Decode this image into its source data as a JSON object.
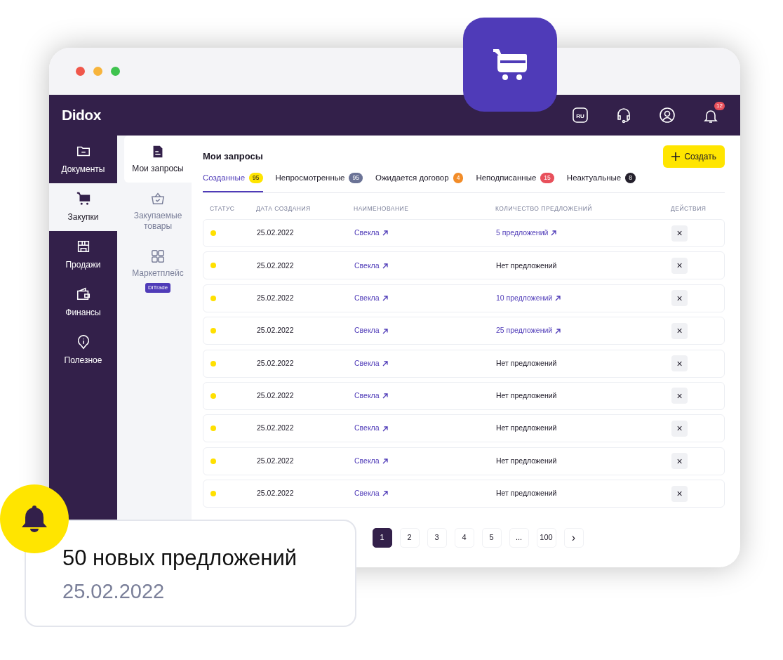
{
  "header": {
    "logo": "Didox",
    "language": "RU",
    "notifications_count": "12"
  },
  "sidebar": {
    "items": [
      {
        "label": "Документы",
        "kind": "folder",
        "selected": false
      },
      {
        "label": "Закупки",
        "kind": "cart",
        "selected": true
      },
      {
        "label": "Продажи",
        "kind": "store",
        "selected": false
      },
      {
        "label": "Финансы",
        "kind": "wallet",
        "selected": false
      },
      {
        "label": "Полезное",
        "kind": "info",
        "selected": false
      }
    ]
  },
  "subnav": {
    "items": [
      {
        "label": "Мои запросы",
        "kind": "doc",
        "selected": true
      },
      {
        "label": "Закупаемые товары",
        "kind": "basket",
        "selected": false
      },
      {
        "label": "Маркетплейс",
        "kind": "grid",
        "selected": false,
        "tag": "DiTrade"
      }
    ]
  },
  "page": {
    "title": "Мои запросы",
    "create_button": "Создать"
  },
  "tabs": [
    {
      "label": "Созданные",
      "count": "95",
      "color": "#ffe500",
      "selected": true
    },
    {
      "label": "Непросмотренные",
      "count": "95",
      "color": "#6b7396",
      "selected": false
    },
    {
      "label": "Ожидается договор",
      "count": "4",
      "color": "#f28c28",
      "selected": false
    },
    {
      "label": "Неподписанные",
      "count": "15",
      "color": "#e8505b",
      "selected": false
    },
    {
      "label": "Неактуальные",
      "count": "8",
      "color": "#24202c",
      "selected": false
    }
  ],
  "table": {
    "columns": [
      "СТАТУС",
      "ДАТА СОЗДАНИЯ",
      "НАИМЕНОВАНИЕ",
      "КОЛИЧЕСТВО ПРЕДЛОЖЕНИЙ",
      "ДЕЙСТВИЯ"
    ],
    "rows": [
      {
        "color": "#ffe000",
        "date": "25.02.2022",
        "name": "Свекла",
        "offers": "5 предложений",
        "kind": "link",
        "action": "×"
      },
      {
        "color": "#ffe000",
        "date": "25.02.2022",
        "name": "Свекла",
        "offers": "Нет предложений",
        "kind": "plain",
        "action": "×"
      },
      {
        "color": "#ffe000",
        "date": "25.02.2022",
        "name": "Свекла",
        "offers": "10 предложений",
        "kind": "link",
        "action": "×"
      },
      {
        "color": "#ffe000",
        "date": "25.02.2022",
        "name": "Свекла",
        "offers": "25 предложений",
        "kind": "link",
        "action": "×"
      },
      {
        "color": "#ffe000",
        "date": "25.02.2022",
        "name": "Свекла",
        "offers": "Нет предложений",
        "kind": "plain",
        "action": "×"
      },
      {
        "color": "#ffe000",
        "date": "25.02.2022",
        "name": "Свекла",
        "offers": "Нет предложений",
        "kind": "plain",
        "action": "×"
      },
      {
        "color": "#ffe000",
        "date": "25.02.2022",
        "name": "Свекла",
        "offers": "Нет предложений",
        "kind": "plain",
        "action": "×"
      },
      {
        "color": "#ffe000",
        "date": "25.02.2022",
        "name": "Свекла",
        "offers": "Нет предложений",
        "kind": "plain",
        "action": "×"
      },
      {
        "color": "#ffe000",
        "date": "25.02.2022",
        "name": "Свекла",
        "offers": "Нет предложений",
        "kind": "plain",
        "action": "×"
      }
    ]
  },
  "pagination": {
    "pages": [
      {
        "label": "1",
        "selected": true
      },
      {
        "label": "2",
        "selected": false
      },
      {
        "label": "3",
        "selected": false
      },
      {
        "label": "4",
        "selected": false
      },
      {
        "label": "5",
        "selected": false
      },
      {
        "label": "...",
        "selected": false
      },
      {
        "label": "100",
        "selected": false
      }
    ],
    "next": "›"
  },
  "toast": {
    "title": "50 новых предложений",
    "date": "25.02.2022"
  }
}
